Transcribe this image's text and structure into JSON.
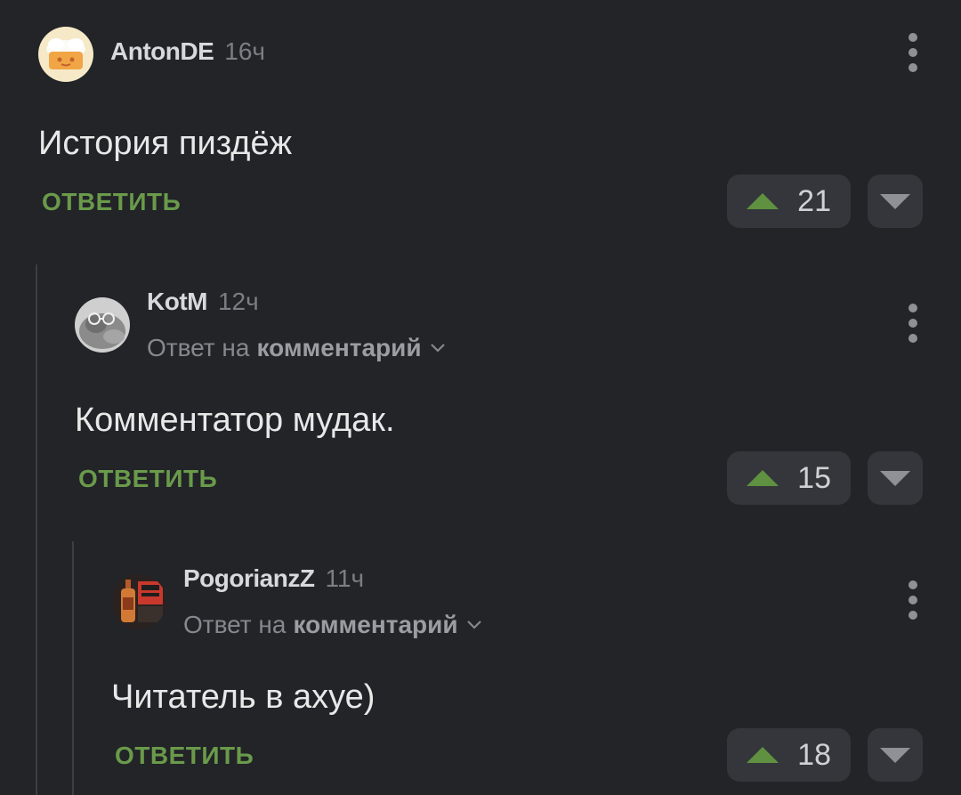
{
  "comments": [
    {
      "author": "AntonDE",
      "time": "16ч",
      "text": "История пиздёж",
      "reply_label": "ОТВЕТИТЬ",
      "rating": "21",
      "reply_to": null
    },
    {
      "author": "KotM",
      "time": "12ч",
      "reply_prefix": "Ответ на",
      "reply_target": "комментарий",
      "text": "Комментатор мудак.",
      "reply_label": "ОТВЕТИТЬ",
      "rating": "15"
    },
    {
      "author": "PogorianzZ",
      "time": "11ч",
      "reply_prefix": "Ответ на",
      "reply_target": "комментарий",
      "text": "Читатель в ахуе)",
      "reply_label": "ОТВЕТИТЬ",
      "rating": "18"
    }
  ],
  "icons": {
    "more": "more-vertical-icon",
    "upvote": "upvote-triangle-icon",
    "downvote": "downvote-triangle-icon",
    "expand": "chevron-down-icon"
  },
  "colors": {
    "background": "#222428",
    "accent_green": "#6a9a4a",
    "button_bg": "#34363b"
  }
}
